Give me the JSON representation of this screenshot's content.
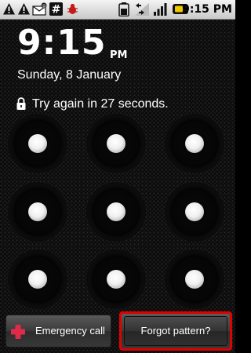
{
  "status_bar": {
    "time": "9:15",
    "time_suffix": "PM",
    "icons": [
      "warning-icon",
      "warning-icon",
      "missed-email-icon",
      "hash-icon",
      "debug-bug-icon",
      "battery-icon",
      "data-signal-icon",
      "signal-strength-icon",
      "sim-icon"
    ]
  },
  "lockscreen": {
    "clock_time": "9:15",
    "ampm": "PM",
    "date": "Sunday, 8 January",
    "status_message": "Try again in 27 seconds."
  },
  "pattern": {
    "rows": 3,
    "cols": 3,
    "dots": [
      "dot-1",
      "dot-2",
      "dot-3",
      "dot-4",
      "dot-5",
      "dot-6",
      "dot-7",
      "dot-8",
      "dot-9"
    ]
  },
  "buttons": {
    "emergency_label": "Emergency call",
    "forgot_label": "Forgot pattern?"
  },
  "colors": {
    "highlight_border": "#e00000",
    "emergency_plus": "#e02a4a",
    "background": "#0b0b0b"
  }
}
